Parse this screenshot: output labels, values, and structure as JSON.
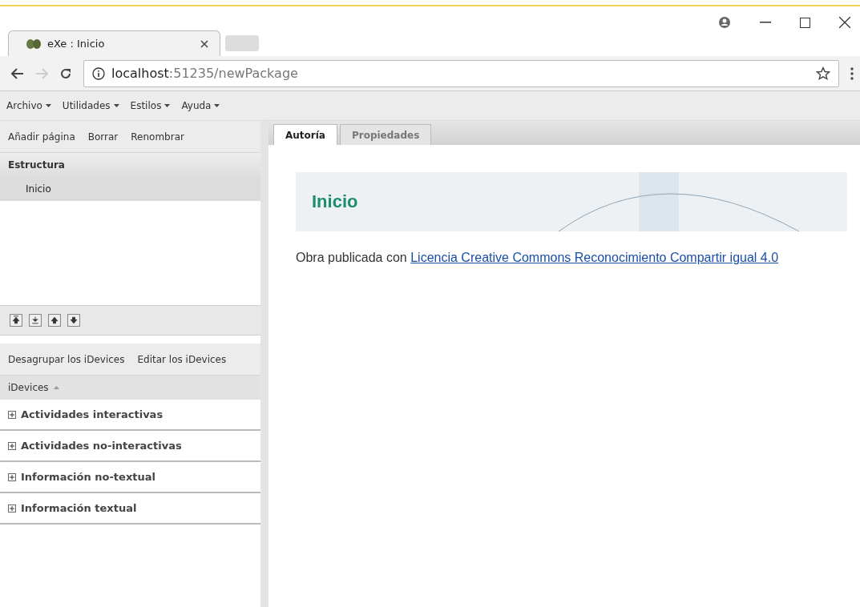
{
  "browser": {
    "tab_title": "eXe : Inicio",
    "address": {
      "host": "localhost",
      "path": ":51235/newPackage"
    }
  },
  "menu": [
    {
      "label": "Archivo"
    },
    {
      "label": "Utilidades"
    },
    {
      "label": "Estilos"
    },
    {
      "label": "Ayuda"
    }
  ],
  "outline_toolbar": [
    "Añadir página",
    "Borrar",
    "Renombrar"
  ],
  "structure": {
    "title": "Estructura",
    "nodes": [
      {
        "label": "Inicio",
        "selected": true
      }
    ]
  },
  "idevice_toolbar": [
    "Desagrupar los iDevices",
    "Editar los iDevices"
  ],
  "idevices": {
    "header": "iDevices",
    "categories": [
      {
        "label": "Actividades interactivas",
        "expanded": false
      },
      {
        "label": "Actividades no-interactivas",
        "expanded": false
      },
      {
        "label": "Información no-textual",
        "expanded": false
      },
      {
        "label": "Información textual",
        "expanded": false
      }
    ]
  },
  "content_tabs": [
    {
      "label": "Autoría",
      "selected": true
    },
    {
      "label": "Propiedades",
      "selected": false
    }
  ],
  "page": {
    "heading": "Inicio",
    "license_prefix": "Obra publicada con",
    "license_link": "Licencia Creative Commons Reconocimiento Compartir igual 4.0"
  }
}
